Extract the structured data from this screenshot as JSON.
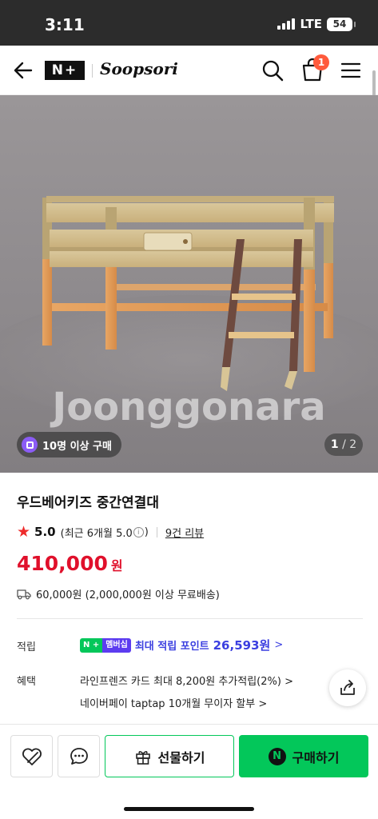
{
  "status_bar": {
    "time": "3:11",
    "network": "LTE",
    "battery": "54"
  },
  "header": {
    "logo": "N+",
    "brand": "Soopsori",
    "cart_count": "1"
  },
  "hero": {
    "watermark": "Joonggonara",
    "buy_badge": "10명 이상 구매",
    "page_current": "1",
    "page_total": "/ 2"
  },
  "product": {
    "title": "우드베어키즈 중간연결대",
    "rating": "5.0",
    "recent_prefix": "(최근 6개월 5.0",
    "recent_suffix": ")",
    "reviews": "9건 리뷰",
    "price": "410,000",
    "currency": "원",
    "shipping": "60,000원 (2,000,000원 이상 무료배송)"
  },
  "details": {
    "points_label": "적립",
    "membership_n": "N +",
    "membership_tag": "멤버십",
    "points_text": "최대 적립 포인트",
    "points_amount": "26,593원",
    "benefit_label": "혜택",
    "benefit_1": "라인프렌즈 카드 최대 8,200원 추가적립(2%) >",
    "benefit_2": "네이버페이 taptap 10개월 무이자 할부 >"
  },
  "bottom_bar": {
    "gift_label": "선물하기",
    "buy_label": "구매하기",
    "buy_logo": "N"
  },
  "colors": {
    "accent_green": "#03c75a",
    "price_red": "#e0102b",
    "points_blue": "#3b3fe0"
  }
}
